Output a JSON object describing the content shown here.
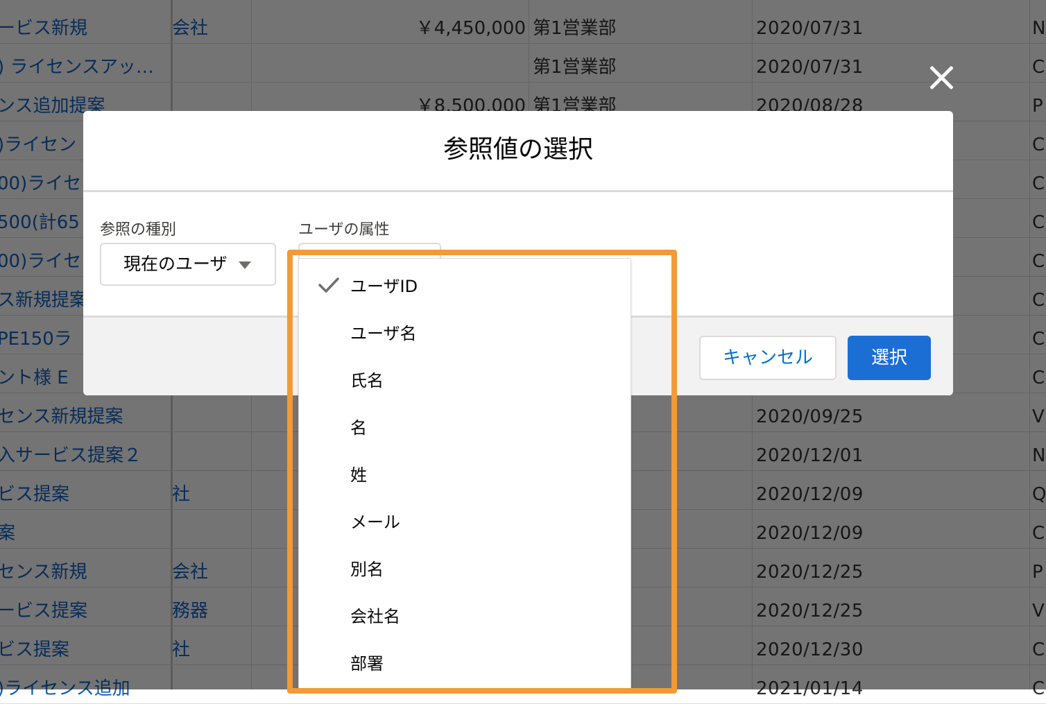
{
  "background_table": {
    "rows": [
      {
        "name": "ービス新規",
        "account": "会社",
        "amount": "￥4,450,000",
        "dept": "第1営業部",
        "date": "2020/07/31",
        "last": "N"
      },
      {
        "name": ") ライセンスアッ…",
        "account": "",
        "amount": "",
        "dept": "第1営業部",
        "date": "2020/07/31",
        "last": "C"
      },
      {
        "name": "ンス追加提案",
        "account": "",
        "amount": "￥8,500,000",
        "dept": "第1営業部",
        "date": "2020/08/28",
        "last": "P"
      },
      {
        "name": ")ライセン",
        "account": "",
        "amount": "",
        "dept": "",
        "date": "",
        "last": "C"
      },
      {
        "name": "00)ライセ",
        "account": "",
        "amount": "",
        "dept": "",
        "date": "",
        "last": "C"
      },
      {
        "name": "500(計65",
        "account": "",
        "amount": "",
        "dept": "",
        "date": "",
        "last": "C"
      },
      {
        "name": "00)ライセ",
        "account": "",
        "amount": "",
        "dept": "",
        "date": "",
        "last": "C"
      },
      {
        "name": "ス新規提案",
        "account": "",
        "amount": "",
        "dept": "",
        "date": "",
        "last": "C"
      },
      {
        "name": "PE150ラ",
        "account": "",
        "amount": "",
        "dept": "",
        "date": "",
        "last": "C"
      },
      {
        "name": "ント様 E",
        "account": "",
        "amount": "",
        "dept": "",
        "date": "",
        "last": "C"
      },
      {
        "name": "センス新規提案",
        "account": "",
        "amount": "",
        "dept": "",
        "date": "2020/09/25",
        "last": "V"
      },
      {
        "name": "入サービス提案２",
        "account": "",
        "amount": "",
        "dept": "",
        "date": "2020/12/01",
        "last": "N"
      },
      {
        "name": "ビス提案",
        "account": "社",
        "amount": "",
        "dept": "",
        "date": "2020/12/09",
        "last": "Q"
      },
      {
        "name": "案",
        "account": "",
        "amount": "",
        "dept": "",
        "date": "2020/12/09",
        "last": "C"
      },
      {
        "name": "センス新規",
        "account": "会社",
        "amount": "",
        "dept": "",
        "date": "2020/12/25",
        "last": "P"
      },
      {
        "name": "ービス提案",
        "account": "務器",
        "amount": "",
        "dept": "",
        "date": "2020/12/25",
        "last": "V"
      },
      {
        "name": "ビス提案",
        "account": "社",
        "amount": "",
        "dept": "",
        "date": "2020/12/30",
        "last": "C"
      },
      {
        "name": ")ライセンス追加",
        "account": "",
        "amount": "",
        "dept": "",
        "date": "2021/01/14",
        "last": "C"
      }
    ]
  },
  "modal": {
    "title": "参照値の選択",
    "reference_type": {
      "label": "参照の種別",
      "value": "現在のユーザ"
    },
    "user_attribute": {
      "label": "ユーザの属性"
    },
    "cancel_label": "キャンセル",
    "select_label": "選択"
  },
  "dropdown": {
    "options": [
      "ユーザID",
      "ユーザ名",
      "氏名",
      "名",
      "姓",
      "メール",
      "別名",
      "会社名",
      "部署"
    ],
    "selected": "ユーザID"
  },
  "colors": {
    "highlight": "#f29a38",
    "brand": "#1b6ed4",
    "link": "#0a5bbf"
  },
  "icons": {
    "close": "close-icon",
    "check": "check-icon",
    "caret": "chevron-down-icon"
  }
}
